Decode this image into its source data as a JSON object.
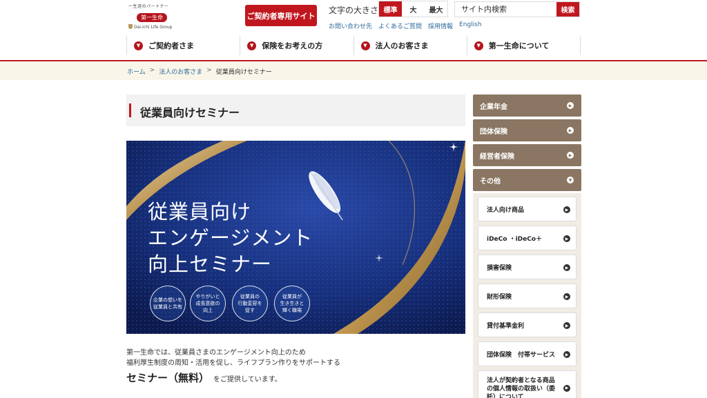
{
  "header": {
    "logo_tagline": "一生涯のパートナー",
    "logo_name": "第一生命",
    "logo_group": "Dai-ichi Life Group",
    "contract_site_label": "ご契約者専用サイト",
    "font_size_label": "文字の大きさ",
    "font_sizes": [
      "標準",
      "大",
      "最大"
    ],
    "search_placeholder": "サイト内検索",
    "search_button": "検索",
    "sublinks": [
      "お問い合わせ先",
      "よくあるご質問",
      "採用情報",
      "English"
    ]
  },
  "nav": {
    "items": [
      "ご契約者さま",
      "保険をお考えの方",
      "法人のお客さま",
      "第一生命について"
    ]
  },
  "breadcrumb": {
    "items": [
      "ホーム",
      "法人のお客さま",
      "従業員向けセミナー"
    ],
    "separator": ">"
  },
  "main": {
    "title": "従業員向けセミナー",
    "banner": {
      "title_lines": [
        "従業員向け",
        "エンゲージメント",
        "向上セミナー"
      ],
      "bubbles": [
        [
          "企業の想いを",
          "従業員と共有"
        ],
        [
          "やりがいと",
          "成長意欲の",
          "向上"
        ],
        [
          "従業員の",
          "行動変容を",
          "促す"
        ],
        [
          "従業員が",
          "生き生きと",
          "輝く職場"
        ]
      ]
    },
    "intro_line1": "第一生命では、従業員さまのエンゲージメント向上のため",
    "intro_line2": "福利厚生制度の周知・活用を促し、ライフプラン作りをサポートする",
    "intro_emphasis": "セミナー（無料）",
    "intro_tail": "をご提供しています。"
  },
  "sidebar": {
    "categories": [
      "企業年金",
      "団体保険",
      "経営者保険",
      "その他"
    ],
    "sub_items": [
      "法人向け商品",
      "iDeCo ・iDeCo＋",
      "損害保険",
      "財形保険",
      "貸付基準金利",
      "団体保険　付帯サービス",
      "法人が契約者となる商品の個人情報の取扱い（委託）について"
    ]
  },
  "colors": {
    "brand_red": "#c0171e",
    "sidebar_brown": "#8a7662",
    "banner_navy": "#14286a",
    "link_blue": "#2d6a9c"
  }
}
